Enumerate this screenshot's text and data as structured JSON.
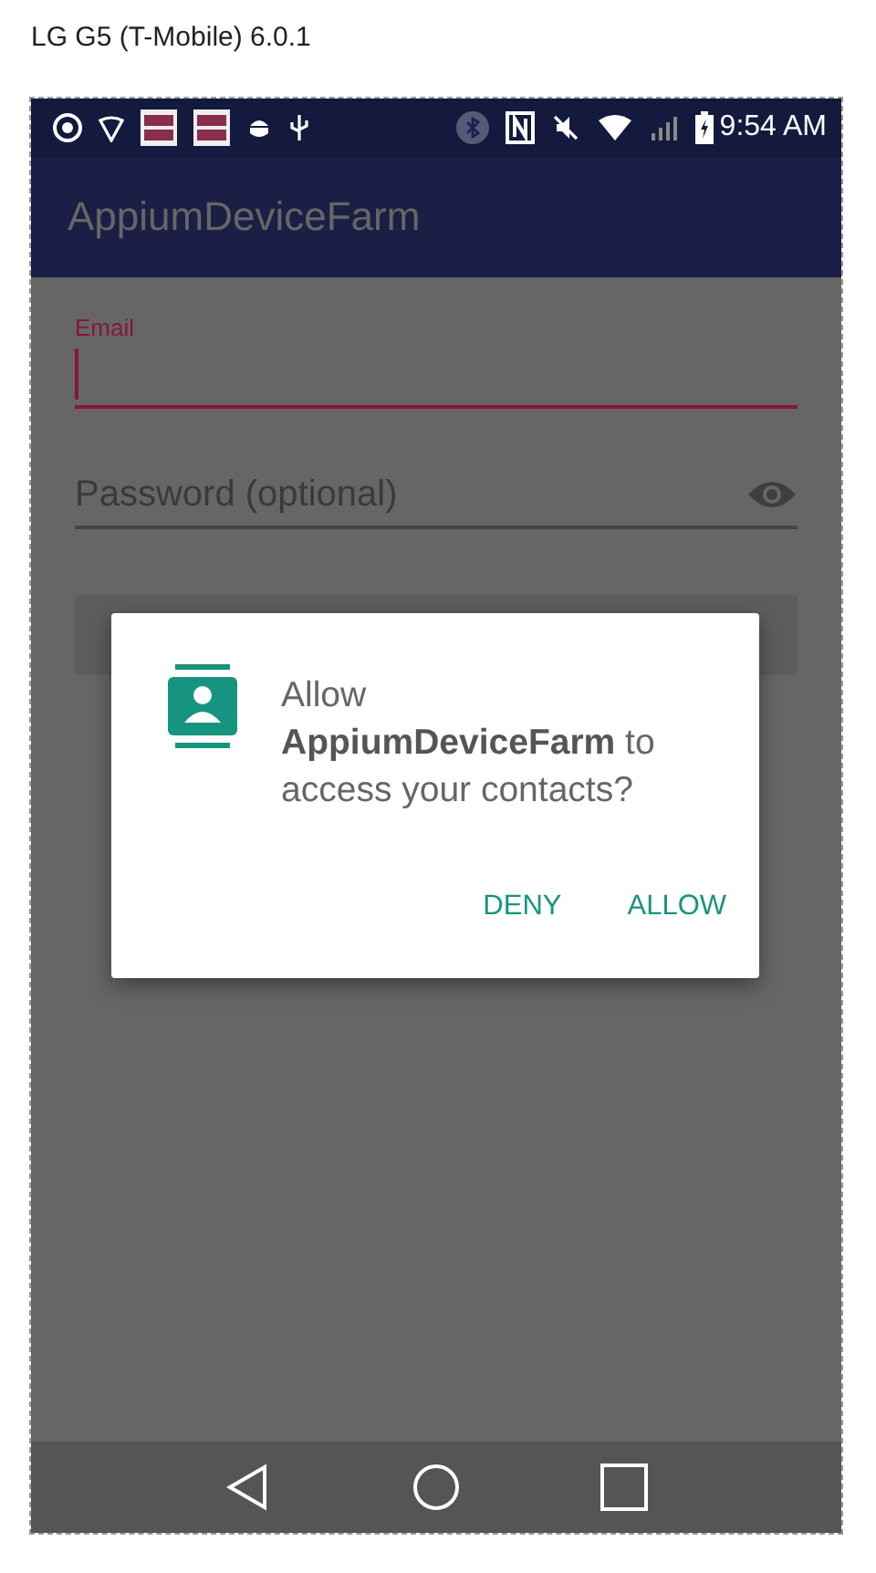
{
  "caption": "LG G5 (T-Mobile) 6.0.1",
  "status_bar": {
    "time": "9:54 AM"
  },
  "app_bar": {
    "title": "AppiumDeviceFarm"
  },
  "form": {
    "fields": [
      {
        "kind": "text",
        "label": "Email",
        "focused": true
      },
      {
        "kind": "password",
        "placeholder": "Password (optional)",
        "focused": false
      }
    ]
  },
  "dialog": {
    "message": "Allow **AppiumDeviceFarm** to access your contacts?",
    "buttons": [
      {
        "label": "DENY"
      },
      {
        "label": "ALLOW"
      }
    ]
  }
}
